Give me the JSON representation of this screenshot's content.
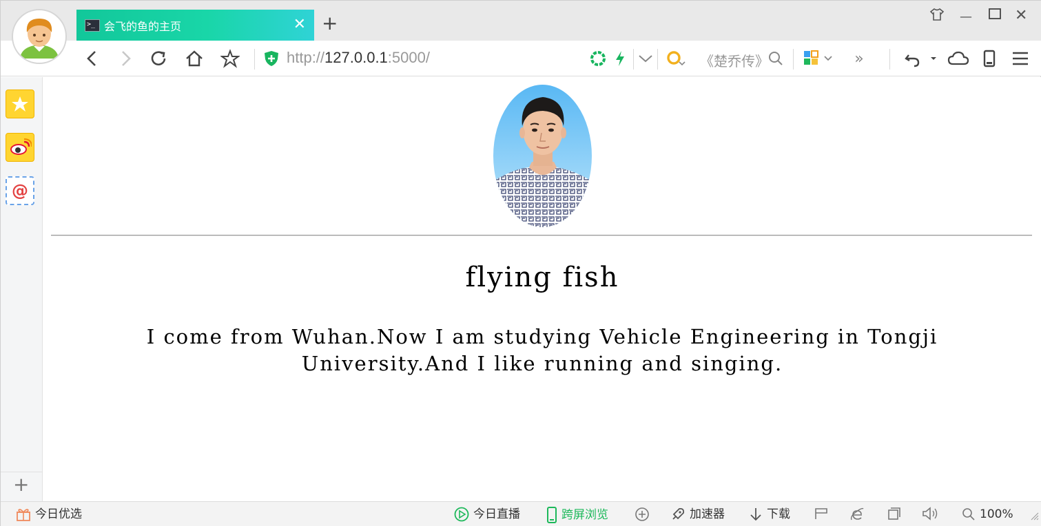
{
  "tab": {
    "title": "会飞的鱼的主页"
  },
  "toolbar": {
    "url_scheme": "http://",
    "url_host": "127.0.0.1",
    "url_port": ":5000/",
    "search_placeholder": "《楚乔传》"
  },
  "page": {
    "name": "flying fish",
    "bio": "I come from Wuhan.Now I am studying Vehicle Engineering in Tongji University.And I like running and singing."
  },
  "statusbar": {
    "today_picks": "今日优选",
    "live": "今日直播",
    "cross_screen": "跨屏浏览",
    "accelerator": "加速器",
    "download": "下载",
    "zoom": "100%"
  },
  "colors": {
    "tab_gradient_start": "#12c79a",
    "tab_gradient_end": "#2fd3d6",
    "cross_screen": "#1cb85a"
  }
}
